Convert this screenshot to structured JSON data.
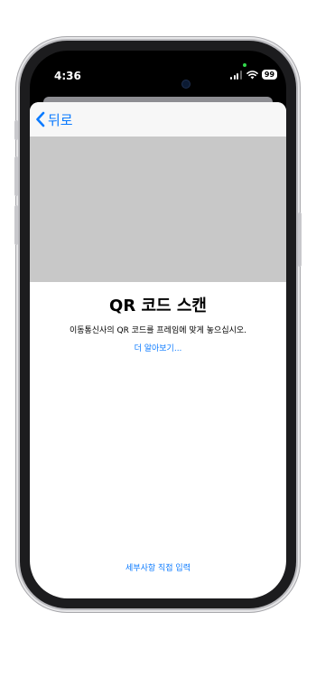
{
  "status_bar": {
    "time": "4:36",
    "battery": "99"
  },
  "nav": {
    "back_label": "뒤로"
  },
  "scan": {
    "title": "QR 코드 스캔",
    "instruction": "이동통신사의 QR 코드를 프레임에 맞게 놓으십시오.",
    "learn_more": "더 알아보기..."
  },
  "footer": {
    "manual_entry": "세부사항 직접 입력"
  },
  "colors": {
    "accent": "#0a7aff",
    "camera_placeholder": "#c8c8c8",
    "nav_background": "#f7f7f7"
  }
}
